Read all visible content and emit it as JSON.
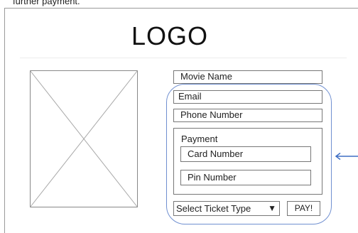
{
  "caption": "further payment.",
  "header": {
    "logo_text": "LOGO"
  },
  "image": {
    "icon": "image-placeholder-icon"
  },
  "form": {
    "movie_name": "Movie Name",
    "email": "Email",
    "phone_number": "Phone Number",
    "payment": {
      "label": "Payment",
      "card_number": "Card Number",
      "pin_number": "Pin Number"
    },
    "ticket_type": {
      "selected": "Select Ticket Type",
      "caret": "▼"
    },
    "pay_label": "PAY!"
  },
  "annotation": {
    "highlight_color": "#6f8fd0",
    "arrow_color": "#3f6fc4"
  }
}
